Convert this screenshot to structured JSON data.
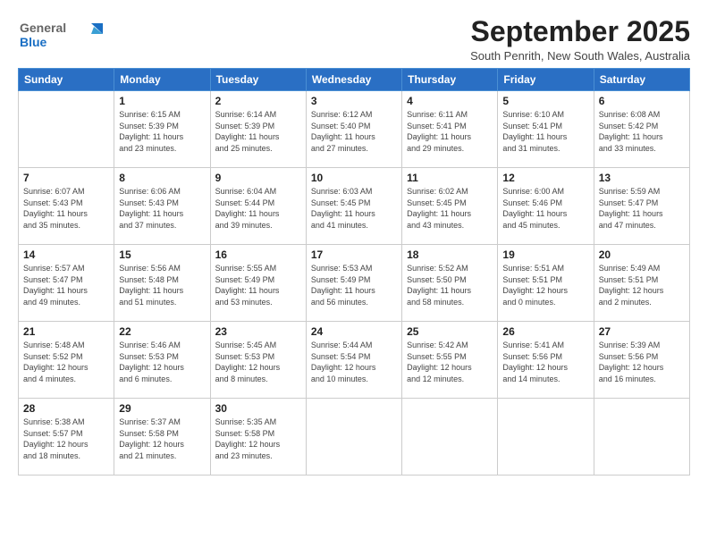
{
  "app": {
    "name": "GeneralBlue"
  },
  "header": {
    "month": "September 2025",
    "location": "South Penrith, New South Wales, Australia"
  },
  "days_of_week": [
    "Sunday",
    "Monday",
    "Tuesday",
    "Wednesday",
    "Thursday",
    "Friday",
    "Saturday"
  ],
  "weeks": [
    [
      {
        "day": "",
        "info": ""
      },
      {
        "day": "1",
        "info": "Sunrise: 6:15 AM\nSunset: 5:39 PM\nDaylight: 11 hours\nand 23 minutes."
      },
      {
        "day": "2",
        "info": "Sunrise: 6:14 AM\nSunset: 5:39 PM\nDaylight: 11 hours\nand 25 minutes."
      },
      {
        "day": "3",
        "info": "Sunrise: 6:12 AM\nSunset: 5:40 PM\nDaylight: 11 hours\nand 27 minutes."
      },
      {
        "day": "4",
        "info": "Sunrise: 6:11 AM\nSunset: 5:41 PM\nDaylight: 11 hours\nand 29 minutes."
      },
      {
        "day": "5",
        "info": "Sunrise: 6:10 AM\nSunset: 5:41 PM\nDaylight: 11 hours\nand 31 minutes."
      },
      {
        "day": "6",
        "info": "Sunrise: 6:08 AM\nSunset: 5:42 PM\nDaylight: 11 hours\nand 33 minutes."
      }
    ],
    [
      {
        "day": "7",
        "info": "Sunrise: 6:07 AM\nSunset: 5:43 PM\nDaylight: 11 hours\nand 35 minutes."
      },
      {
        "day": "8",
        "info": "Sunrise: 6:06 AM\nSunset: 5:43 PM\nDaylight: 11 hours\nand 37 minutes."
      },
      {
        "day": "9",
        "info": "Sunrise: 6:04 AM\nSunset: 5:44 PM\nDaylight: 11 hours\nand 39 minutes."
      },
      {
        "day": "10",
        "info": "Sunrise: 6:03 AM\nSunset: 5:45 PM\nDaylight: 11 hours\nand 41 minutes."
      },
      {
        "day": "11",
        "info": "Sunrise: 6:02 AM\nSunset: 5:45 PM\nDaylight: 11 hours\nand 43 minutes."
      },
      {
        "day": "12",
        "info": "Sunrise: 6:00 AM\nSunset: 5:46 PM\nDaylight: 11 hours\nand 45 minutes."
      },
      {
        "day": "13",
        "info": "Sunrise: 5:59 AM\nSunset: 5:47 PM\nDaylight: 11 hours\nand 47 minutes."
      }
    ],
    [
      {
        "day": "14",
        "info": "Sunrise: 5:57 AM\nSunset: 5:47 PM\nDaylight: 11 hours\nand 49 minutes."
      },
      {
        "day": "15",
        "info": "Sunrise: 5:56 AM\nSunset: 5:48 PM\nDaylight: 11 hours\nand 51 minutes."
      },
      {
        "day": "16",
        "info": "Sunrise: 5:55 AM\nSunset: 5:49 PM\nDaylight: 11 hours\nand 53 minutes."
      },
      {
        "day": "17",
        "info": "Sunrise: 5:53 AM\nSunset: 5:49 PM\nDaylight: 11 hours\nand 56 minutes."
      },
      {
        "day": "18",
        "info": "Sunrise: 5:52 AM\nSunset: 5:50 PM\nDaylight: 11 hours\nand 58 minutes."
      },
      {
        "day": "19",
        "info": "Sunrise: 5:51 AM\nSunset: 5:51 PM\nDaylight: 12 hours\nand 0 minutes."
      },
      {
        "day": "20",
        "info": "Sunrise: 5:49 AM\nSunset: 5:51 PM\nDaylight: 12 hours\nand 2 minutes."
      }
    ],
    [
      {
        "day": "21",
        "info": "Sunrise: 5:48 AM\nSunset: 5:52 PM\nDaylight: 12 hours\nand 4 minutes."
      },
      {
        "day": "22",
        "info": "Sunrise: 5:46 AM\nSunset: 5:53 PM\nDaylight: 12 hours\nand 6 minutes."
      },
      {
        "day": "23",
        "info": "Sunrise: 5:45 AM\nSunset: 5:53 PM\nDaylight: 12 hours\nand 8 minutes."
      },
      {
        "day": "24",
        "info": "Sunrise: 5:44 AM\nSunset: 5:54 PM\nDaylight: 12 hours\nand 10 minutes."
      },
      {
        "day": "25",
        "info": "Sunrise: 5:42 AM\nSunset: 5:55 PM\nDaylight: 12 hours\nand 12 minutes."
      },
      {
        "day": "26",
        "info": "Sunrise: 5:41 AM\nSunset: 5:56 PM\nDaylight: 12 hours\nand 14 minutes."
      },
      {
        "day": "27",
        "info": "Sunrise: 5:39 AM\nSunset: 5:56 PM\nDaylight: 12 hours\nand 16 minutes."
      }
    ],
    [
      {
        "day": "28",
        "info": "Sunrise: 5:38 AM\nSunset: 5:57 PM\nDaylight: 12 hours\nand 18 minutes."
      },
      {
        "day": "29",
        "info": "Sunrise: 5:37 AM\nSunset: 5:58 PM\nDaylight: 12 hours\nand 21 minutes."
      },
      {
        "day": "30",
        "info": "Sunrise: 5:35 AM\nSunset: 5:58 PM\nDaylight: 12 hours\nand 23 minutes."
      },
      {
        "day": "",
        "info": ""
      },
      {
        "day": "",
        "info": ""
      },
      {
        "day": "",
        "info": ""
      },
      {
        "day": "",
        "info": ""
      }
    ]
  ]
}
